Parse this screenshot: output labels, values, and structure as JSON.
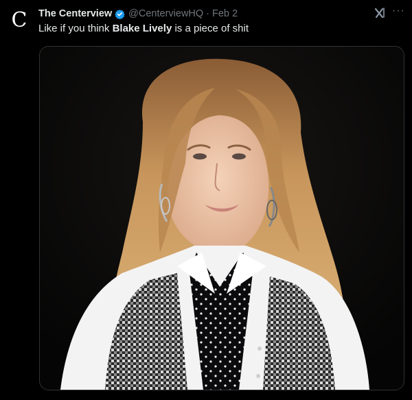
{
  "tweet": {
    "avatar_letter": "C",
    "display_name": "The Centerview",
    "handle": "@CenterviewHQ",
    "separator": "·",
    "date": "Feb 2",
    "text_prefix": "Like if you think ",
    "text_bold": "Blake Lively",
    "text_suffix": " is a piece of shit",
    "more_label": "···"
  },
  "icons": {
    "verified": "verified-badge-icon",
    "grok": "grok-icon",
    "more": "more-options-icon"
  },
  "colors": {
    "background": "#000000",
    "text": "#e7e9ea",
    "muted": "#71767b",
    "verified": "#1d9bf0",
    "border": "#2f3336"
  }
}
